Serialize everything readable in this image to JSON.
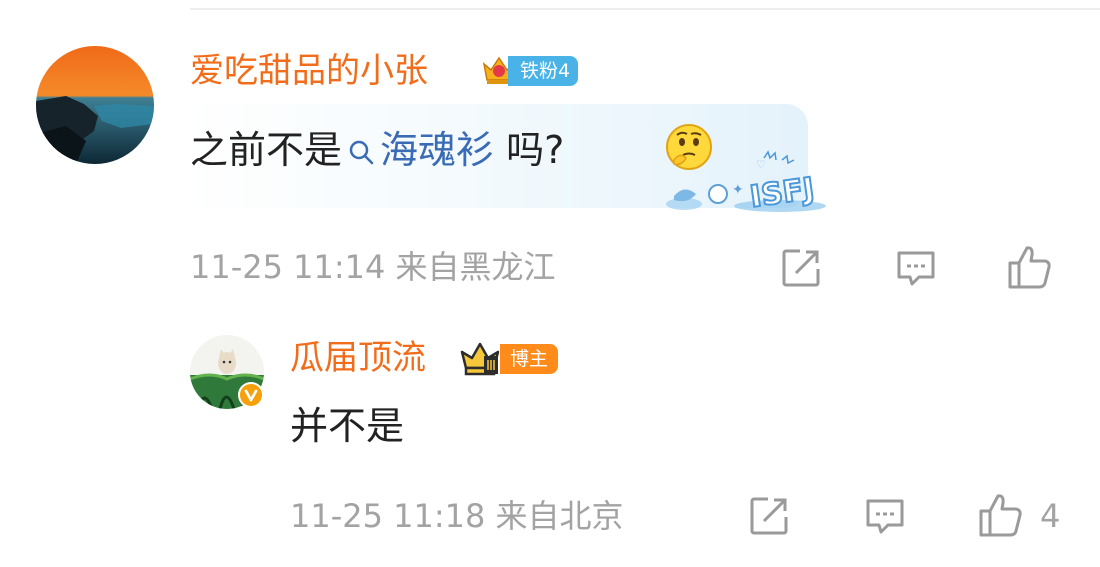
{
  "comment": {
    "username": "爱吃甜品的小张",
    "badge_icon": "crown-icon",
    "fan_badge": "铁粉4",
    "text_before": "之前不是",
    "topic_link": "海魂衫",
    "text_after": " 吗?",
    "emoji": "thinking-face",
    "sticker_text": "ISFJ",
    "time": "11-25 11:14",
    "location": "来自黑龙江",
    "actions": [
      "share",
      "comment",
      "like"
    ]
  },
  "reply": {
    "username": "瓜届顶流",
    "badge_icon": "crown-icon",
    "host_badge": "博主",
    "text": "并不是",
    "time": "11-25 11:18",
    "location": "来自北京",
    "like_count": "4",
    "actions": [
      "share",
      "comment",
      "like"
    ]
  },
  "colors": {
    "username": "#f26d1b",
    "topic_link": "#3a6bb5",
    "meta_text": "#a3a3a3",
    "fan_badge_bg": "#49b3e8",
    "host_badge_bg": "#ff8b1a"
  }
}
